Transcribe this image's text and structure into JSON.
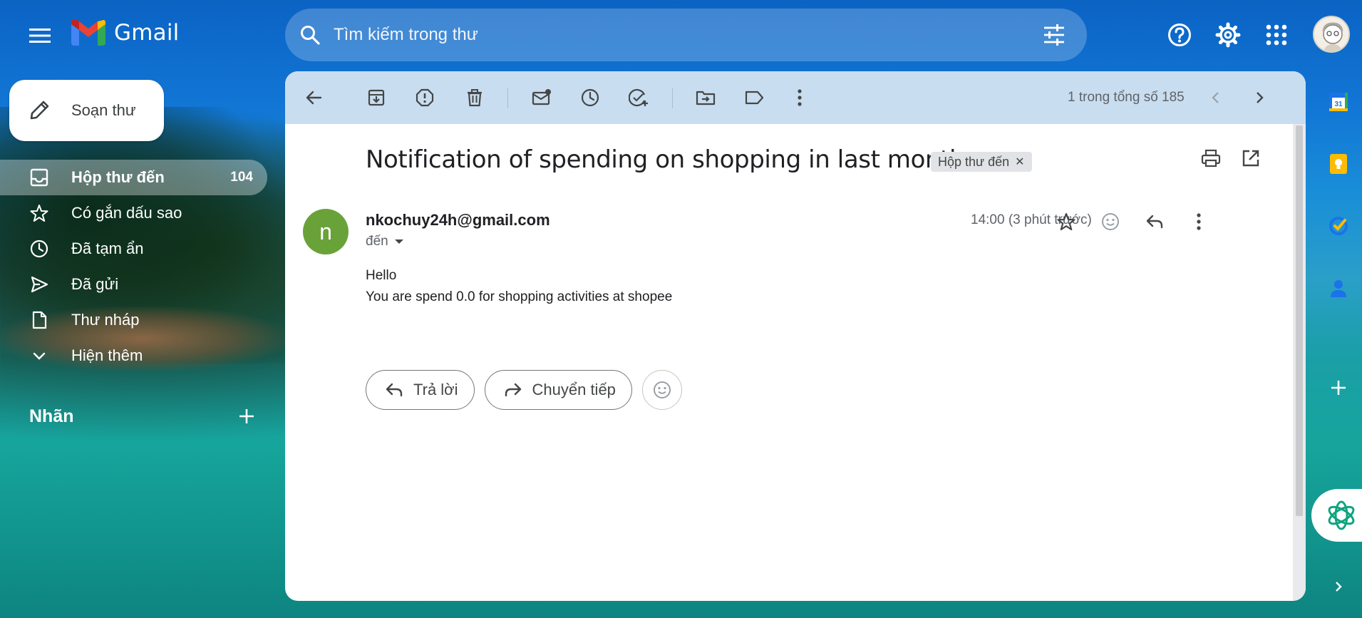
{
  "app": {
    "name": "Gmail",
    "brand_colors": {
      "red": "#ea4335",
      "blue": "#4285f4",
      "green": "#34a853",
      "yellow": "#fbbc04"
    }
  },
  "search": {
    "placeholder": "Tìm kiếm trong thư",
    "value": ""
  },
  "compose": {
    "label": "Soạn thư"
  },
  "sidebar": {
    "items": [
      {
        "label": "Hộp thư đến",
        "count": "104",
        "icon": "inbox-icon",
        "active": true
      },
      {
        "label": "Có gắn dấu sao",
        "icon": "star-icon"
      },
      {
        "label": "Đã tạm ẩn",
        "icon": "clock-icon"
      },
      {
        "label": "Đã gửi",
        "icon": "send-icon"
      },
      {
        "label": "Thư nháp",
        "icon": "draft-icon"
      },
      {
        "label": "Hiện thêm",
        "icon": "chevron-down-icon"
      }
    ],
    "labels_heading": "Nhãn"
  },
  "toolbar": {
    "pager": "1 trong tổng số 185"
  },
  "email": {
    "subject": "Notification of spending on shopping in last month",
    "tag": "Hộp thư đến",
    "sender_initial": "n",
    "sender_color": "#6aa23a",
    "sender": "nkochuy24h@gmail.com",
    "to_label": "đến",
    "time": "14:00 (3 phút trước)",
    "body_lines": [
      "Hello",
      "You are spend 0.0 for shopping activities at shopee"
    ]
  },
  "actions": {
    "reply": "Trả lời",
    "forward": "Chuyển tiếp"
  }
}
